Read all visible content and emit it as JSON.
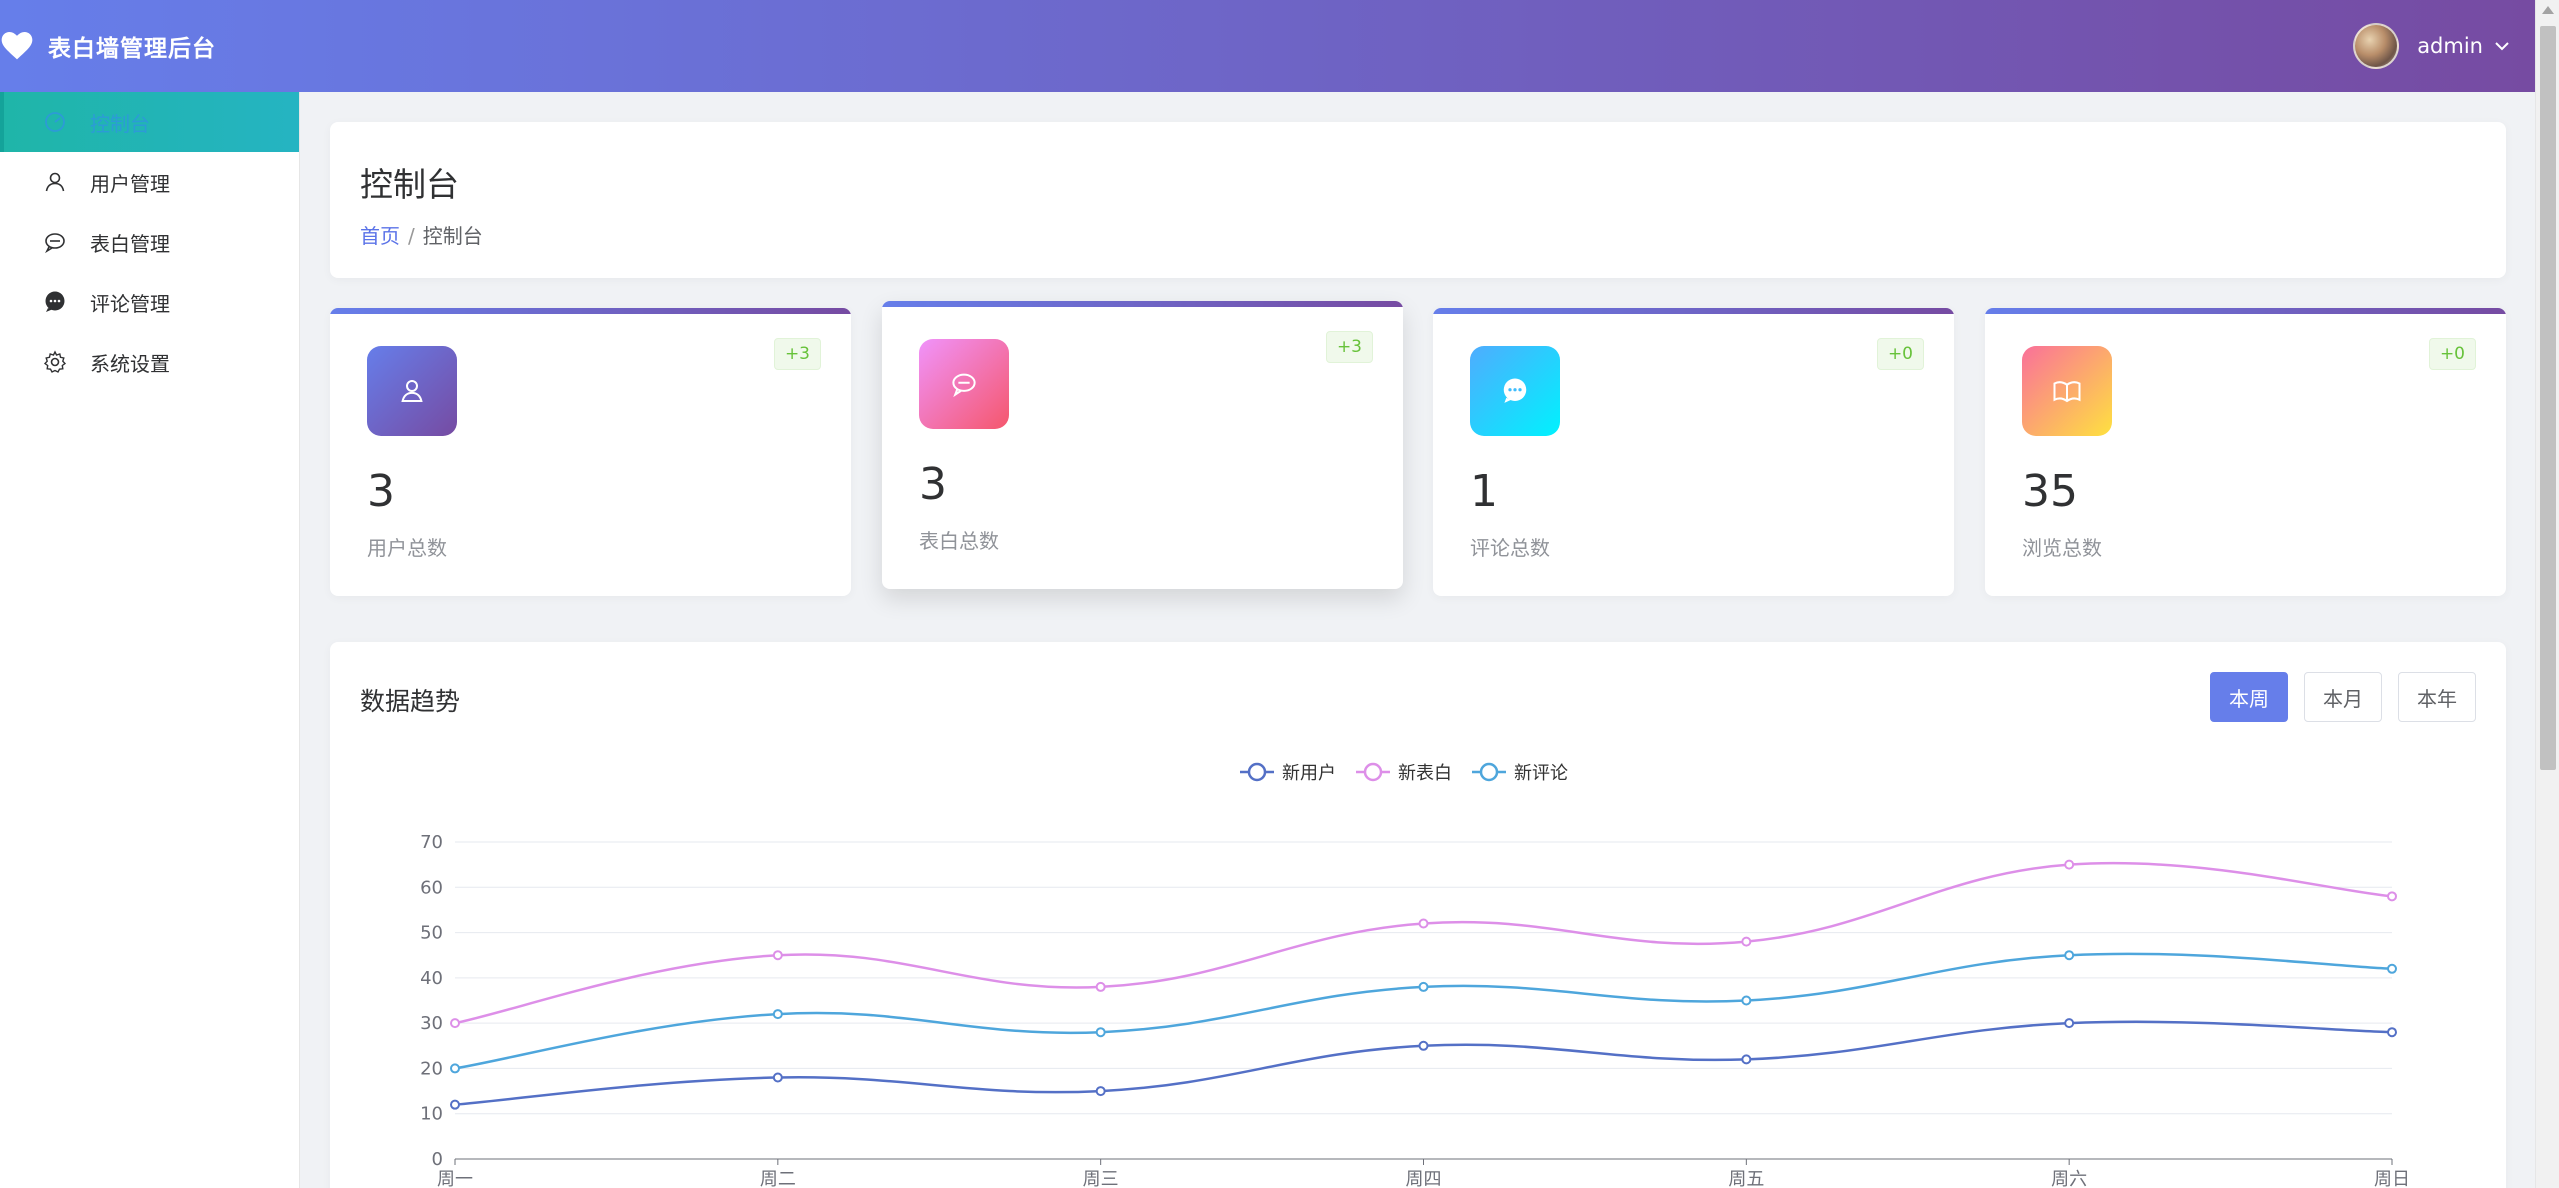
{
  "header": {
    "app_title": "表白墙管理后台",
    "user_name": "admin",
    "logo_icon": "heart-icon",
    "caret_icon": "chevron-down-icon"
  },
  "sidebar": {
    "items": [
      {
        "label": "控制台",
        "icon": "dashboard-icon",
        "active": true
      },
      {
        "label": "用户管理",
        "icon": "user-icon",
        "active": false
      },
      {
        "label": "表白管理",
        "icon": "chat-bubble-icon",
        "active": false
      },
      {
        "label": "评论管理",
        "icon": "comment-icon",
        "active": false
      },
      {
        "label": "系统设置",
        "icon": "gear-icon",
        "active": false
      }
    ]
  },
  "page": {
    "title": "控制台",
    "breadcrumb": {
      "home": "首页",
      "separator": "/",
      "current": "控制台"
    }
  },
  "stats": [
    {
      "value": "3",
      "label": "用户总数",
      "badge": "+3",
      "icon": "user-icon",
      "gradient": [
        "#667eea",
        "#764ba2"
      ]
    },
    {
      "value": "3",
      "label": "表白总数",
      "badge": "+3",
      "icon": "chat-bubble-icon",
      "gradient": [
        "#f093fb",
        "#f5576c"
      ]
    },
    {
      "value": "1",
      "label": "评论总数",
      "badge": "+0",
      "icon": "comment-icon",
      "gradient": [
        "#4facfe",
        "#00f2fe"
      ]
    },
    {
      "value": "35",
      "label": "浏览总数",
      "badge": "+0",
      "icon": "book-icon",
      "gradient": [
        "#fa709a",
        "#fee140"
      ]
    }
  ],
  "trend": {
    "title": "数据趋势",
    "ranges": [
      {
        "label": "本周",
        "active": true
      },
      {
        "label": "本月",
        "active": false
      },
      {
        "label": "本年",
        "active": false
      }
    ]
  },
  "chart_data": {
    "type": "line",
    "smooth": true,
    "categories": [
      "周一",
      "周二",
      "周三",
      "周四",
      "周五",
      "周六",
      "周日"
    ],
    "series": [
      {
        "name": "新用户",
        "color": "#5470c6",
        "values": [
          12,
          18,
          15,
          25,
          22,
          30,
          28
        ]
      },
      {
        "name": "新表白",
        "color": "#dd8fe8",
        "values": [
          30,
          45,
          38,
          52,
          48,
          65,
          58
        ]
      },
      {
        "name": "新评论",
        "color": "#4ea6dc",
        "values": [
          20,
          32,
          28,
          38,
          35,
          45,
          42
        ]
      }
    ],
    "ylim": [
      0,
      70
    ],
    "yticks": [
      0,
      10,
      20,
      30,
      40,
      50,
      60,
      70
    ],
    "grid": true,
    "legend": "top-center"
  },
  "colors": {
    "header_gradient": [
      "#667eea",
      "#764ba2"
    ],
    "active_menu": "#1fb5a8",
    "badge_green": "#67c23a"
  }
}
